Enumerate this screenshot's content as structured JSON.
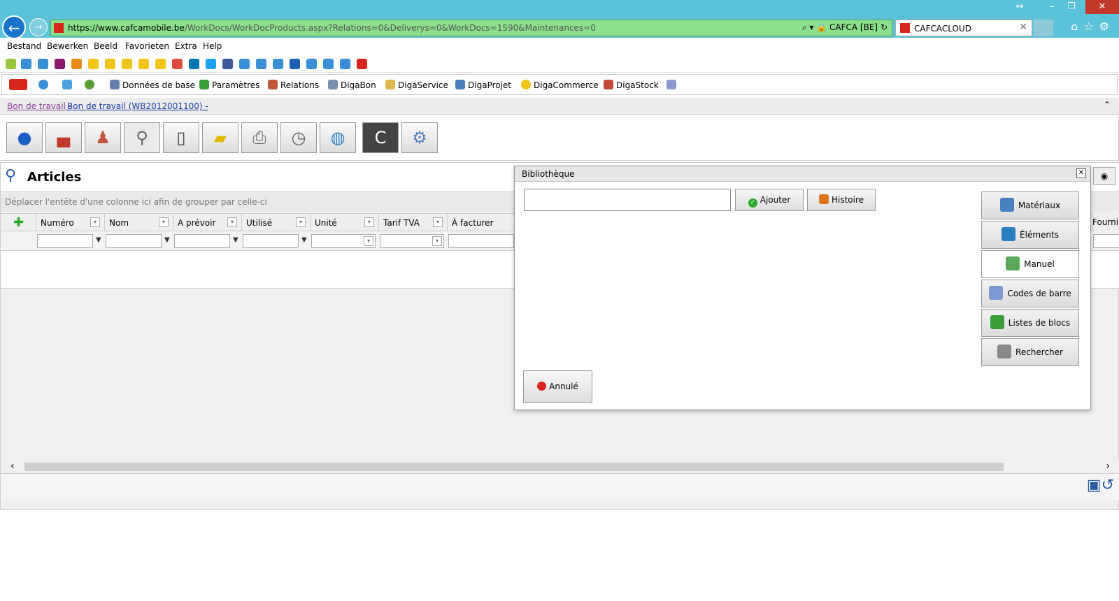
{
  "browser": {
    "url_domain": "https://www.cafcamobile.be",
    "url_path": "/WorkDocs/WorkDocProducts.aspx?Relations=0&Deliverys=0&WorkDocs=1590&Maintenances=0",
    "site_identity": "CAFCA [BE]",
    "tab_title": "CAFCACLOUD"
  },
  "menu": [
    "Bestand",
    "Bewerken",
    "Beeld",
    "Favorieten",
    "Extra",
    "Help"
  ],
  "app_toolbar": {
    "items": [
      "Données de base",
      "Paramètres",
      "Relations",
      "DigaBon",
      "DigaService",
      "DigaProjet",
      "DigaCommerce",
      "DigaStock"
    ]
  },
  "breadcrumb": {
    "part1": "Bon de travail -",
    "part2": "Bon de travail (WB2012001100) -"
  },
  "articles": {
    "title": "Articles",
    "group_hint": "Déplacer l'entête d'une colonne ici afin de grouper par celle-ci",
    "columns": [
      "Numéro",
      "Nom",
      "A prévoir",
      "Utilisé",
      "Unité",
      "Tarif TVA",
      "À facturer"
    ],
    "right_column": "Fourniss"
  },
  "dialog": {
    "title": "Bibliothèque",
    "search_value": "",
    "add_label": "Ajouter",
    "history_label": "Histoire",
    "cancel_label": "Annulé",
    "side_buttons": [
      "Matériaux",
      "Éléments",
      "Manuel",
      "Codes de barre",
      "Listes de blocs",
      "Rechercher"
    ],
    "active_side": "Manuel"
  },
  "colors": {
    "titlebar": "#5bc3d9",
    "addressbar": "#8be08b",
    "link_visited": "#8b3c9c",
    "link": "#1a3ea8",
    "brand_red": "#d9261c"
  }
}
